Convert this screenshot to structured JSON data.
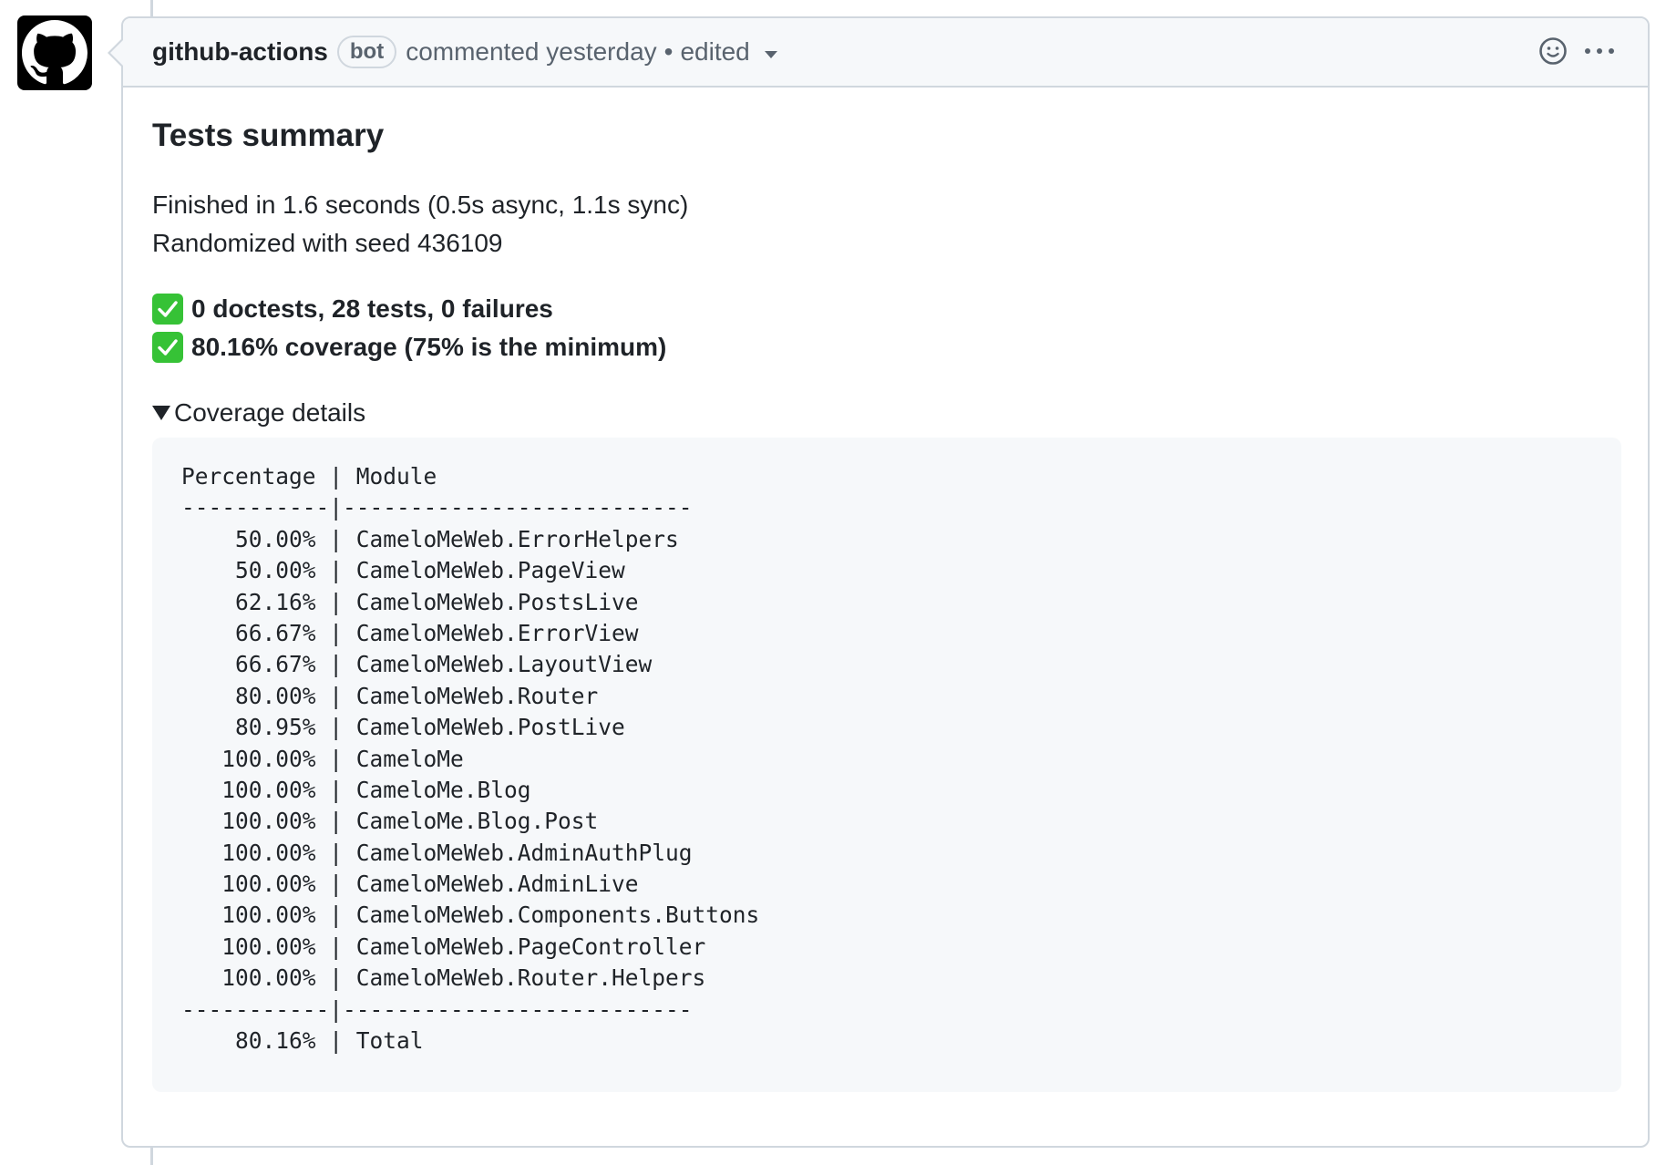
{
  "comment": {
    "author": "github-actions",
    "badge": "bot",
    "meta": "commented yesterday",
    "separator": "•",
    "edited": "edited"
  },
  "icons": {
    "avatar": "github-octocat-icon",
    "reaction": "smiley-icon",
    "menu": "kebab-horizontal-icon",
    "check": "white-check-mark-icon"
  },
  "body": {
    "title": "Tests summary",
    "finished": "Finished in 1.6 seconds (0.5s async, 1.1s sync)",
    "seed": "Randomized with seed 436109",
    "check_tests": "0 doctests, 28 tests, 0 failures",
    "check_coverage": "80.16% coverage (75% is the minimum)",
    "details_summary": "Coverage details"
  },
  "coverage_table": {
    "header": "Percentage | Module",
    "divider": "-----------|--------------------------",
    "rows": [
      "    50.00% | CameloMeWeb.ErrorHelpers",
      "    50.00% | CameloMeWeb.PageView",
      "    62.16% | CameloMeWeb.PostsLive",
      "    66.67% | CameloMeWeb.ErrorView",
      "    66.67% | CameloMeWeb.LayoutView",
      "    80.00% | CameloMeWeb.Router",
      "    80.95% | CameloMeWeb.PostLive",
      "   100.00% | CameloMe",
      "   100.00% | CameloMe.Blog",
      "   100.00% | CameloMe.Blog.Post",
      "   100.00% | CameloMeWeb.AdminAuthPlug",
      "   100.00% | CameloMeWeb.AdminLive",
      "   100.00% | CameloMeWeb.Components.Buttons",
      "   100.00% | CameloMeWeb.PageController",
      "   100.00% | CameloMeWeb.Router.Helpers"
    ],
    "total": "    80.16% | Total"
  }
}
